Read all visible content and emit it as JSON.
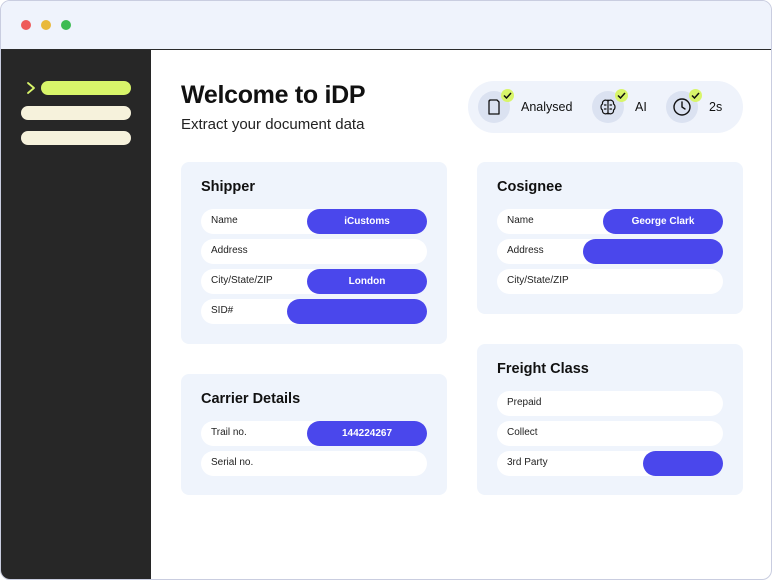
{
  "window": {
    "title_bar_buttons": [
      "close",
      "minimize",
      "maximize"
    ]
  },
  "sidebar": {
    "items": [
      {
        "state": "active"
      },
      {
        "state": "inactive"
      },
      {
        "state": "inactive"
      }
    ]
  },
  "header": {
    "title": "Welcome to iDP",
    "subtitle": "Extract your document data"
  },
  "status": [
    {
      "icon": "document-icon",
      "label": "Analysed"
    },
    {
      "icon": "brain-icon",
      "label": "AI"
    },
    {
      "icon": "clock-icon",
      "label": "2s"
    }
  ],
  "shipper": {
    "title": "Shipper",
    "fields": [
      {
        "label": "Name",
        "value": "iCustoms"
      },
      {
        "label": "Address",
        "value": ""
      },
      {
        "label": "City/State/ZIP",
        "value": "London"
      },
      {
        "label": "SID#",
        "value": ""
      }
    ]
  },
  "carrier": {
    "title": "Carrier Details",
    "fields": [
      {
        "label": "Trail no.",
        "value": "144224267"
      },
      {
        "label": "Serial no.",
        "value": ""
      }
    ]
  },
  "consignee": {
    "title": "Cosignee",
    "fields": [
      {
        "label": "Name",
        "value": "George Clark"
      },
      {
        "label": "Address",
        "value": ""
      },
      {
        "label": "City/State/ZIP",
        "value": ""
      }
    ]
  },
  "freight": {
    "title": "Freight Class",
    "fields": [
      {
        "label": "Prepaid",
        "value": ""
      },
      {
        "label": "Collect",
        "value": ""
      },
      {
        "label": "3rd Party",
        "value": ""
      }
    ]
  },
  "colors": {
    "accent": "#4a47ec",
    "highlight": "#d8f56a",
    "sidebar": "#272727",
    "card": "#eff4fc"
  }
}
